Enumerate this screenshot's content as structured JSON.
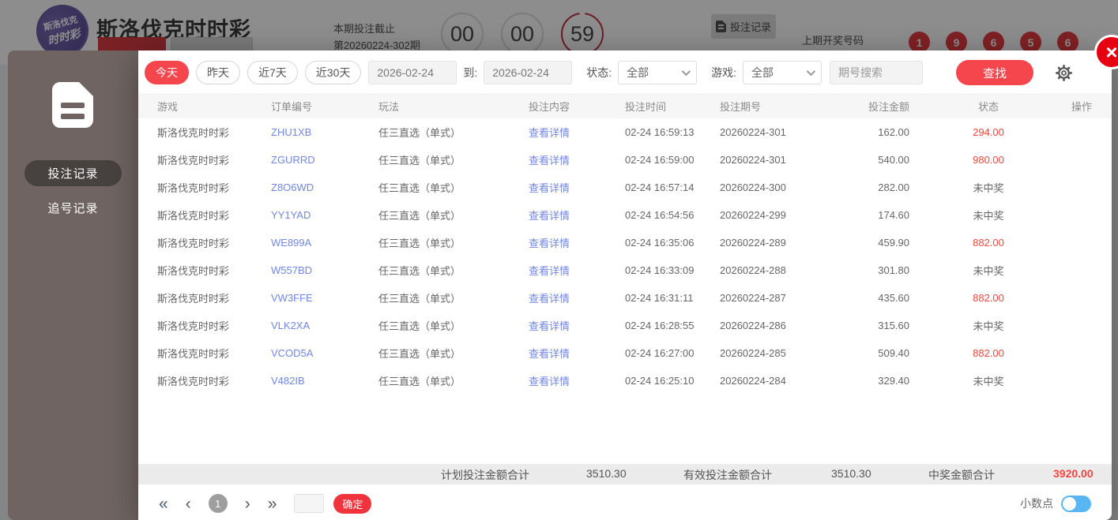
{
  "header": {
    "logo": {
      "line1": "斯洛伐克",
      "line2": "时时彩"
    },
    "title": "斯洛伐克时时彩",
    "deadline_label": "本期投注截止",
    "deadline_period": "第20260224-302期",
    "countdown": [
      "00",
      "00",
      "59"
    ],
    "record_button": "投注记录",
    "last_draw_label": "上期开奖号码",
    "last_draw_balls": [
      "1",
      "9",
      "6",
      "5",
      "6"
    ]
  },
  "sidebar": {
    "items": [
      {
        "label": "投注记录",
        "active": true
      },
      {
        "label": "追号记录",
        "active": false
      }
    ]
  },
  "filters": {
    "quick": [
      {
        "label": "今天",
        "active": true
      },
      {
        "label": "昨天",
        "active": false
      },
      {
        "label": "近7天",
        "active": false
      },
      {
        "label": "近30天",
        "active": false
      }
    ],
    "date_from": "2026-02-24",
    "to_label": "到:",
    "date_to": "2026-02-24",
    "status_label": "状态:",
    "status_value": "全部",
    "game_label": "游戏:",
    "game_value": "全部",
    "search_placeholder": "期号搜索",
    "search_button": "查找"
  },
  "table": {
    "columns": [
      "游戏",
      "订单编号",
      "玩法",
      "投注内容",
      "投注时间",
      "投注期号",
      "投注金额",
      "状态",
      "操作"
    ],
    "detail_link": "查看详情",
    "rows": [
      {
        "game": "斯洛伐克时时彩",
        "order": "ZHU1XB",
        "play": "任三直选（单式）",
        "time": "02-24 16:59:13",
        "period": "20260224-301",
        "amount": "162.00",
        "status": "294.00",
        "won": true
      },
      {
        "game": "斯洛伐克时时彩",
        "order": "ZGURRD",
        "play": "任三直选（单式）",
        "time": "02-24 16:59:00",
        "period": "20260224-301",
        "amount": "540.00",
        "status": "980.00",
        "won": true
      },
      {
        "game": "斯洛伐克时时彩",
        "order": "Z8O6WD",
        "play": "任三直选（单式）",
        "time": "02-24 16:57:14",
        "period": "20260224-300",
        "amount": "282.00",
        "status": "未中奖",
        "won": false
      },
      {
        "game": "斯洛伐克时时彩",
        "order": "YY1YAD",
        "play": "任三直选（单式）",
        "time": "02-24 16:54:56",
        "period": "20260224-299",
        "amount": "174.60",
        "status": "未中奖",
        "won": false
      },
      {
        "game": "斯洛伐克时时彩",
        "order": "WE899A",
        "play": "任三直选（单式）",
        "time": "02-24 16:35:06",
        "period": "20260224-289",
        "amount": "459.90",
        "status": "882.00",
        "won": true
      },
      {
        "game": "斯洛伐克时时彩",
        "order": "W557BD",
        "play": "任三直选（单式）",
        "time": "02-24 16:33:09",
        "period": "20260224-288",
        "amount": "301.80",
        "status": "未中奖",
        "won": false
      },
      {
        "game": "斯洛伐克时时彩",
        "order": "VW3FFE",
        "play": "任三直选（单式）",
        "time": "02-24 16:31:11",
        "period": "20260224-287",
        "amount": "435.60",
        "status": "882.00",
        "won": true
      },
      {
        "game": "斯洛伐克时时彩",
        "order": "VLK2XA",
        "play": "任三直选（单式）",
        "time": "02-24 16:28:55",
        "period": "20260224-286",
        "amount": "315.60",
        "status": "未中奖",
        "won": false
      },
      {
        "game": "斯洛伐克时时彩",
        "order": "VCOD5A",
        "play": "任三直选（单式）",
        "time": "02-24 16:27:00",
        "period": "20260224-285",
        "amount": "509.40",
        "status": "882.00",
        "won": true
      },
      {
        "game": "斯洛伐克时时彩",
        "order": "V482IB",
        "play": "任三直选（单式）",
        "time": "02-24 16:25:10",
        "period": "20260224-284",
        "amount": "329.40",
        "status": "未中奖",
        "won": false
      }
    ]
  },
  "summary": {
    "planned_label": "计划投注金额合计",
    "planned_value": "3510.30",
    "valid_label": "有效投注金额合计",
    "valid_value": "3510.30",
    "win_label": "中奖金额合计",
    "win_value": "3920.00"
  },
  "pagination": {
    "first": "«",
    "prev": "‹",
    "current": "1",
    "next": "›",
    "last": "»",
    "confirm_label": "确定"
  },
  "footer_toggle": {
    "label": "小数点",
    "on": true
  },
  "close_glyph": "×",
  "colors": {
    "accent": "#f5464d",
    "win": "#f5453d",
    "link": "#7186e8",
    "ball": "#e8343a",
    "overlay": "rgba(12,12,12,0.47)"
  }
}
